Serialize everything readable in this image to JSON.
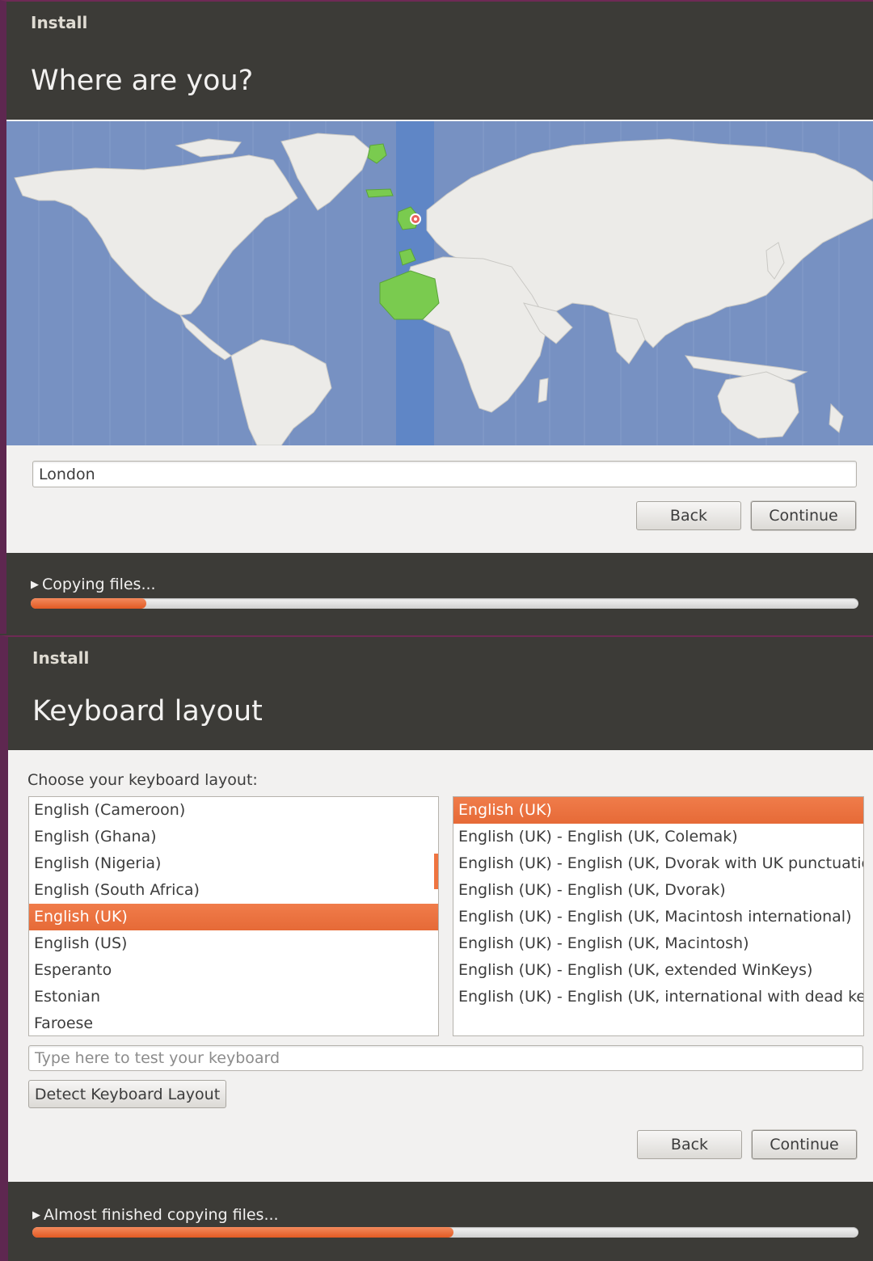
{
  "screen1": {
    "app_title": "Install",
    "page_title": "Where are you?",
    "timezone_value": "London",
    "back_label": "Back",
    "continue_label": "Continue",
    "status": "Copying files...",
    "progress": 0.14
  },
  "screen2": {
    "app_title": "Install",
    "page_title": "Keyboard layout",
    "choose_label": "Choose your keyboard layout:",
    "languages": [
      "English (Cameroon)",
      "English (Ghana)",
      "English (Nigeria)",
      "English (South Africa)",
      "English (UK)",
      "English (US)",
      "Esperanto",
      "Estonian",
      "Faroese"
    ],
    "languages_selected": 4,
    "variants": [
      "English (UK)",
      "English (UK) - English (UK, Colemak)",
      "English (UK) - English (UK, Dvorak with UK punctuation)",
      "English (UK) - English (UK, Dvorak)",
      "English (UK) - English (UK, Macintosh international)",
      "English (UK) - English (UK, Macintosh)",
      "English (UK) - English (UK, extended WinKeys)",
      "English (UK) - English (UK, international with dead keys)"
    ],
    "variants_selected": 0,
    "test_placeholder": "Type here to test your keyboard",
    "detect_label": "Detect Keyboard Layout",
    "back_label": "Back",
    "continue_label": "Continue",
    "status": "Almost finished copying files...",
    "progress": 0.51
  },
  "colors": {
    "accent": "#e95420",
    "selection": "#f07c4a",
    "header": "#3c3b37",
    "map_ocean": "#7791c2",
    "map_land": "#ecebe8",
    "timezone_band": "#5f86c6",
    "timezone_highlight": "#7acb4f"
  },
  "icons": {
    "expander": "triangle-right-icon",
    "location_pin": "location-pin-icon"
  }
}
